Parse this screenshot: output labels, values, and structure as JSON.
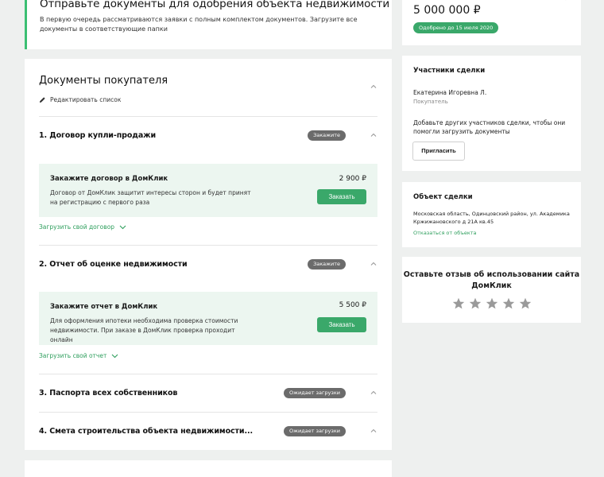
{
  "banner": {
    "title": "Отправьте документы для одобрения объекта недвижимости",
    "text": "В первую очередь рассматриваются заявки с полным комплектом документов. Загрузите все документы в соответствующие папки"
  },
  "docs": {
    "title": "Документы покупателя",
    "edit_label": "Редактировать список",
    "sections": [
      {
        "title": "1. Договор купли-продажи",
        "badge": "Закажите",
        "order": {
          "title": "Закажите договор в ДомКлик",
          "desc": "Договор от ДомКлик защитит интересы сторон и будет принят на регистрацию с первого раза",
          "price": "2 900 ₽",
          "button": "Заказать"
        },
        "upload": "Загрузить свой договор"
      },
      {
        "title": "2. Отчет об оценке недвижимости",
        "badge": "Закажите",
        "order": {
          "title": "Закажите отчет в ДомКлик",
          "desc": "Для оформления ипотеки необходима проверка стоимости недвижимости. При заказе в ДомКлик проверка проходит онлайн",
          "price": "5 500 ₽",
          "button": "Заказать"
        },
        "upload": "Загрузить свой отчет"
      },
      {
        "title": "3. Паспорта всех собственников",
        "badge": "Ожидает загрузки"
      },
      {
        "title": "4. Смета строительства объекта недвижимости...",
        "badge": "Ожидает загрузки"
      }
    ]
  },
  "price_card": {
    "amount": "5 000 000 ₽",
    "approved": "Одобрено до 15 июля 2020"
  },
  "participants": {
    "title": "Участники сделки",
    "person_name": "Екатерина Игоревна Л.",
    "person_role": "Покупатель",
    "hint": "Добавьте других участников сделки, чтобы они помогли загрузить документы",
    "invite_button": "Пригласить"
  },
  "object": {
    "title": "Объект сделки",
    "address": "Московская область, Одинцовский район, ул. Академика Кржижановского д 21А кв.45",
    "link": "Отказаться от объекта"
  },
  "review": {
    "question": "Оставьте отзыв об использовании сайта ДомКлик",
    "stars_total": 5
  },
  "colors": {
    "accent": "#3aa86a",
    "badge_gray": "#6b6b6b",
    "order_bg": "#ecf6f0",
    "page_bg": "#eef0ef",
    "star": "#9a9a9a"
  }
}
